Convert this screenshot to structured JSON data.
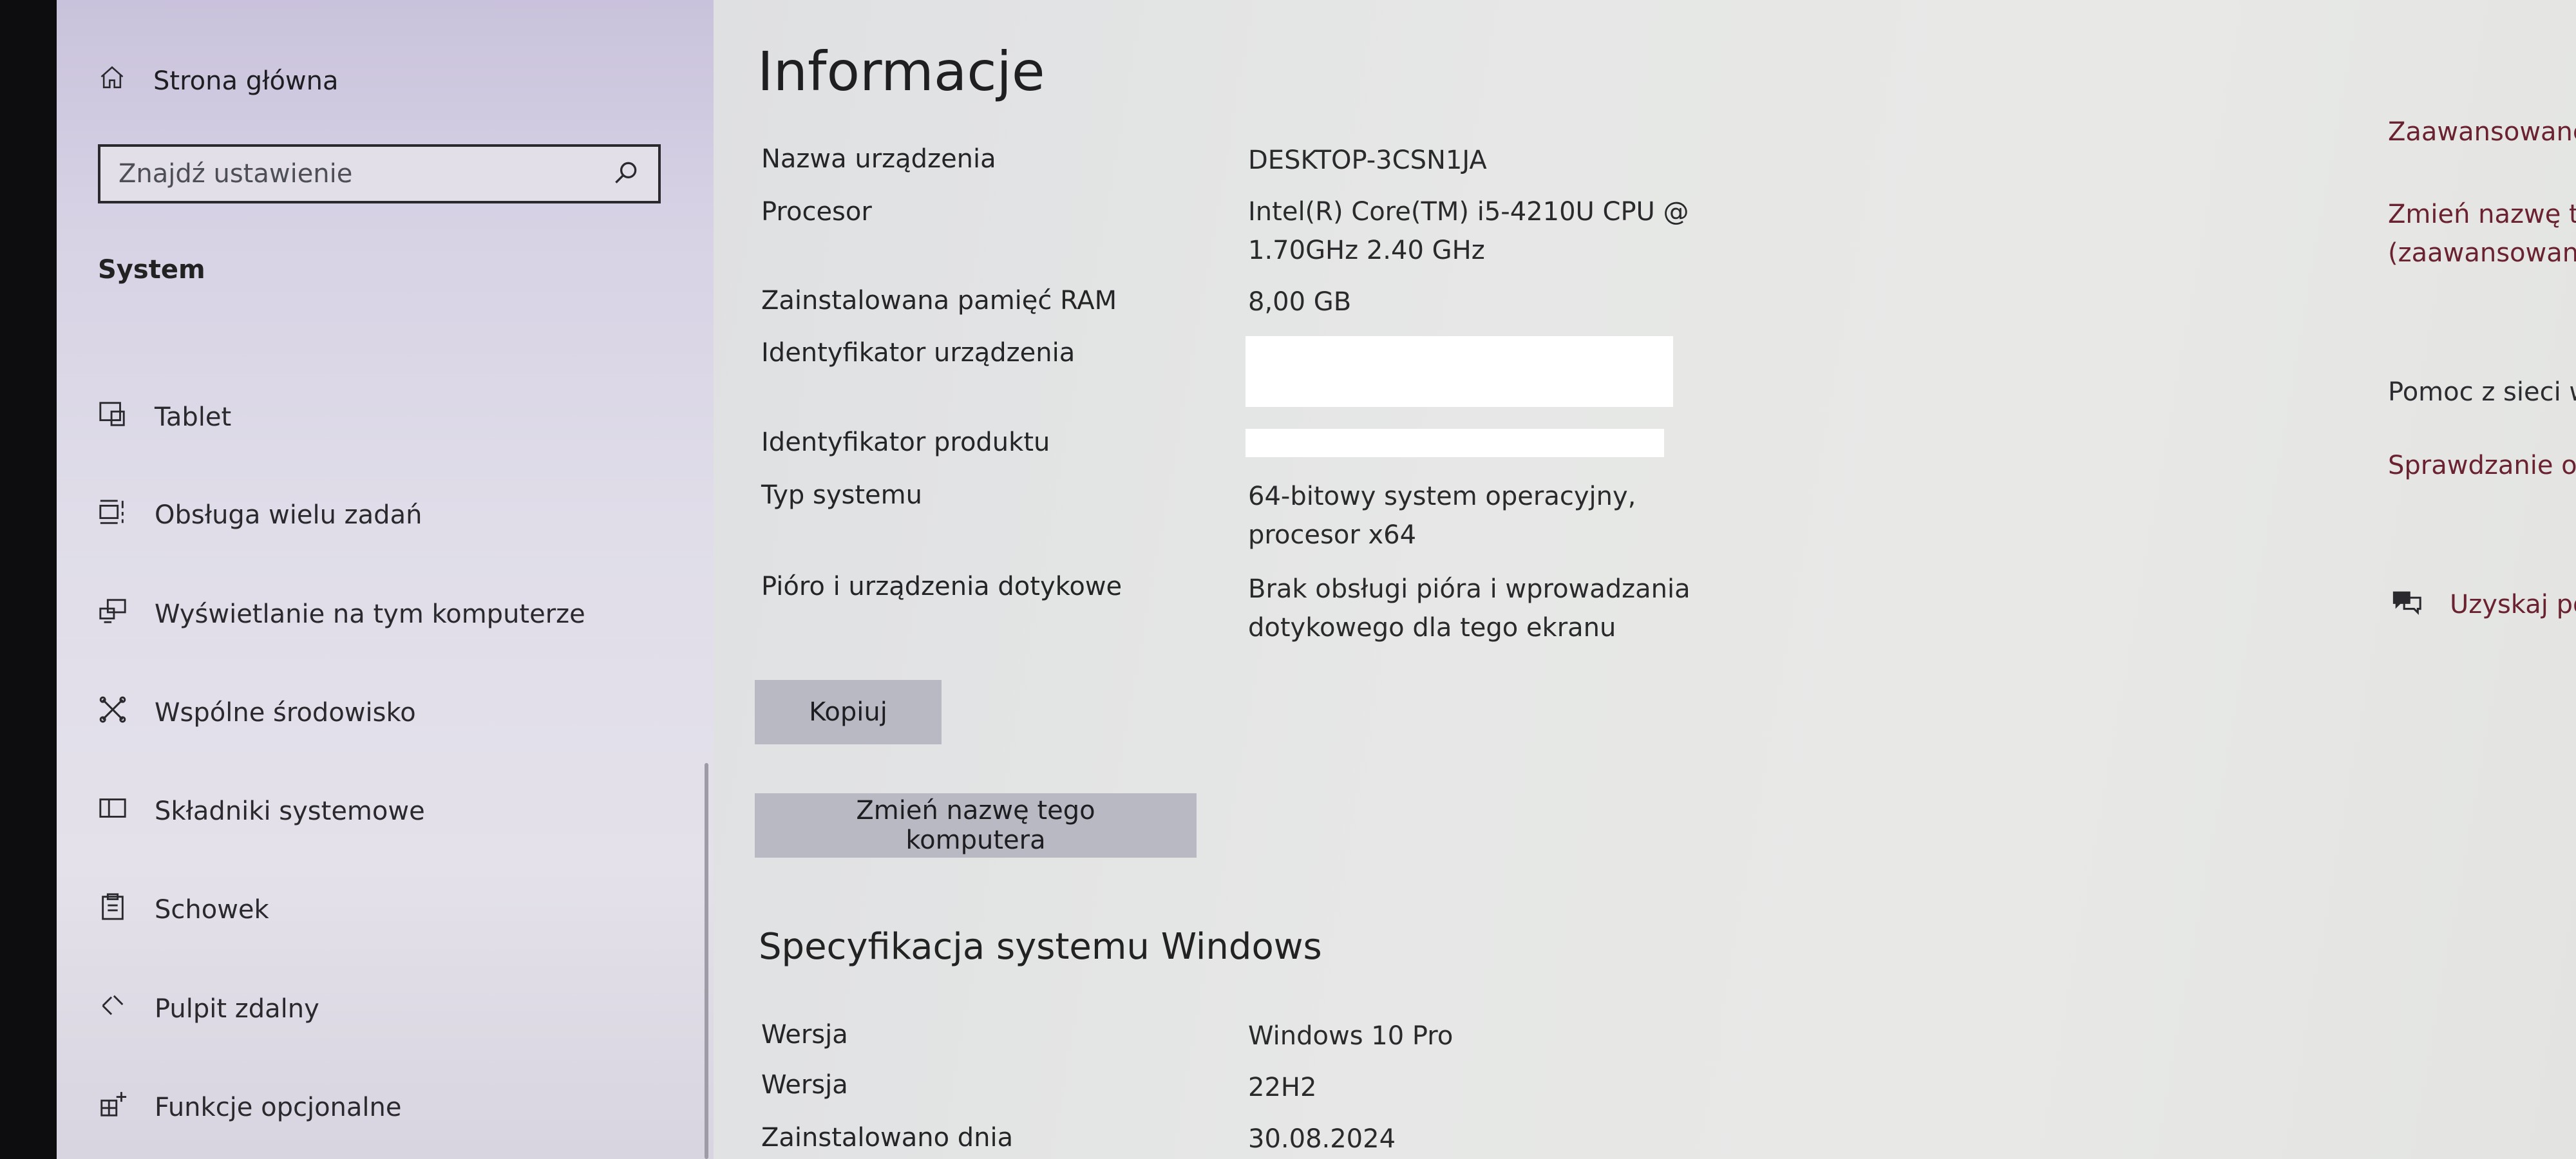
{
  "sidebar": {
    "home_label": "Strona główna",
    "search_placeholder": "Znajdź ustawienie",
    "section_title": "System",
    "items": [
      {
        "label": "Tablet",
        "icon": "tablet-icon"
      },
      {
        "label": "Obsługa wielu zadań",
        "icon": "multitasking-icon"
      },
      {
        "label": "Wyświetlanie na tym komputerze",
        "icon": "projecting-icon"
      },
      {
        "label": "Wspólne środowisko",
        "icon": "shared-experiences-icon"
      },
      {
        "label": "Składniki systemowe",
        "icon": "system-components-icon"
      },
      {
        "label": "Schowek",
        "icon": "clipboard-icon"
      },
      {
        "label": "Pulpit zdalny",
        "icon": "remote-desktop-icon"
      },
      {
        "label": "Funkcje opcjonalne",
        "icon": "optional-features-icon"
      }
    ]
  },
  "main": {
    "title": "Informacje",
    "device_specs": {
      "device_name_label": "Nazwa urządzenia",
      "device_name_value": "DESKTOP-3CSN1JA",
      "processor_label": "Procesor",
      "processor_value_line1": "Intel(R) Core(TM) i5-4210U CPU @",
      "processor_value_line2": "1.70GHz   2.40 GHz",
      "ram_label": "Zainstalowana pamięć RAM",
      "ram_value": "8,00 GB",
      "device_id_label": "Identyfikator urządzenia",
      "product_id_label": "Identyfikator produktu",
      "system_type_label": "Typ systemu",
      "system_type_line1": "64-bitowy system operacyjny,",
      "system_type_line2": "procesor x64",
      "pen_touch_label": "Pióro i urządzenia dotykowe",
      "pen_touch_line1": "Brak obsługi pióra i wprowadzania",
      "pen_touch_line2": "dotykowego dla tego ekranu"
    },
    "copy_button": "Kopiuj",
    "rename_button": "Zmień nazwę tego komputera",
    "windows_spec": {
      "title": "Specyfikacja systemu Windows",
      "edition_label": "Wersja",
      "edition_value": "Windows 10 Pro",
      "version_label": "Wersja",
      "version_value": "22H2",
      "installed_label": "Zainstalowano dnia",
      "installed_value": "30.08.2024"
    }
  },
  "related": {
    "advanced_settings": "Zaawansowane ust",
    "rename_advanced_line1": "Zmień nazwę tego",
    "rename_advanced_line2": "(zaawansowane)",
    "web_help": "Pomoc z sieci web",
    "check_service": "Sprawdzanie obsłu",
    "get_help": "Uzyskaj pom"
  },
  "colors": {
    "link": "#6b2230",
    "button_bg": "#b8b9c2",
    "sidebar_top": "#c9c2dc"
  }
}
